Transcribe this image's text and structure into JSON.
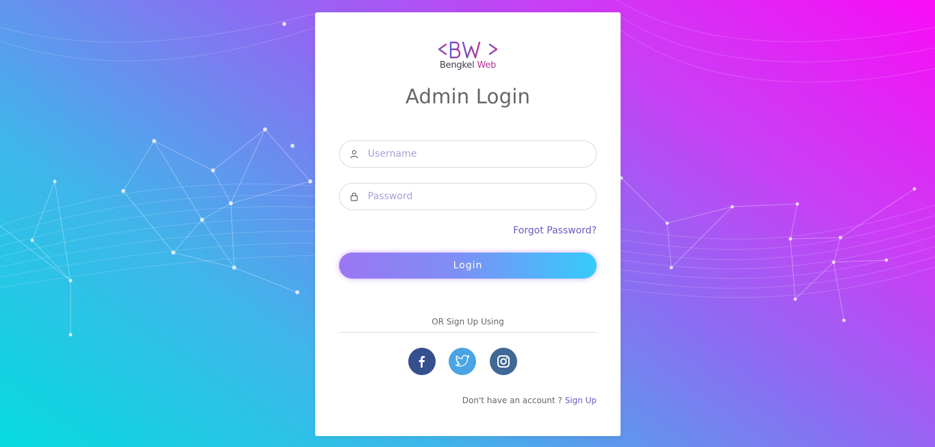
{
  "app": {
    "brand_name_part1": "Bengkel",
    "brand_name_part2": "Web",
    "title": "Admin Login"
  },
  "form": {
    "username": {
      "placeholder": "Username",
      "value": "",
      "icon": "user-icon"
    },
    "password": {
      "placeholder": "Password",
      "value": "",
      "icon": "lock-icon"
    },
    "forgot_label": "Forgot Password?",
    "login_label": "Login"
  },
  "social": {
    "heading": "OR Sign Up Using",
    "buttons": [
      {
        "name": "facebook",
        "icon": "facebook-icon",
        "color": "#34508f"
      },
      {
        "name": "twitter",
        "icon": "twitter-icon",
        "color": "#4aa4e4"
      },
      {
        "name": "instagram",
        "icon": "instagram-icon",
        "color": "#3f6896"
      }
    ]
  },
  "footer": {
    "prompt": "Don't have an account ?",
    "signup_label": "Sign Up"
  },
  "colors": {
    "accent": "#6c5bc4",
    "gradient_start": "#06dbe0",
    "gradient_end": "#f90cf6",
    "button_start": "#9a76f3",
    "button_end": "#35ccf9"
  }
}
